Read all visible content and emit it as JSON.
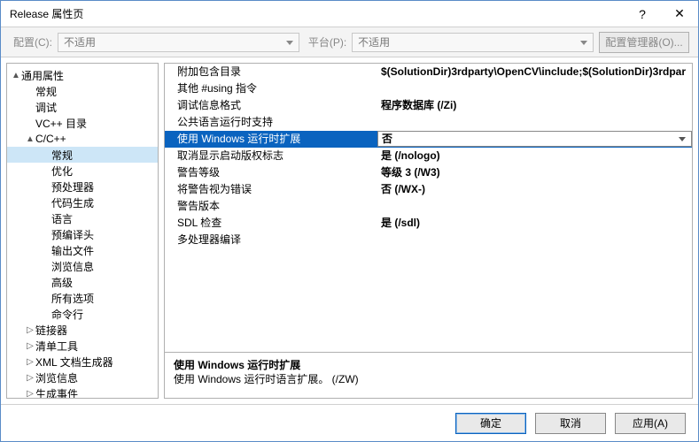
{
  "titlebar": {
    "title": "Release 属性页",
    "help": "?",
    "close": "✕"
  },
  "toolbar": {
    "config_label": "配置(C):",
    "config_value": "不适用",
    "platform_label": "平台(P):",
    "platform_value": "不适用",
    "manager": "配置管理器(O)..."
  },
  "tree": {
    "items": [
      {
        "label": "通用属性",
        "d": 0,
        "exp": "▲"
      },
      {
        "label": "常规",
        "d": 1,
        "exp": ""
      },
      {
        "label": "调试",
        "d": 1,
        "exp": ""
      },
      {
        "label": "VC++ 目录",
        "d": 1,
        "exp": ""
      },
      {
        "label": "C/C++",
        "d": 1,
        "exp": "▲"
      },
      {
        "label": "常规",
        "d": 2,
        "exp": "",
        "sel": true
      },
      {
        "label": "优化",
        "d": 2,
        "exp": ""
      },
      {
        "label": "预处理器",
        "d": 2,
        "exp": ""
      },
      {
        "label": "代码生成",
        "d": 2,
        "exp": ""
      },
      {
        "label": "语言",
        "d": 2,
        "exp": ""
      },
      {
        "label": "预编译头",
        "d": 2,
        "exp": ""
      },
      {
        "label": "输出文件",
        "d": 2,
        "exp": ""
      },
      {
        "label": "浏览信息",
        "d": 2,
        "exp": ""
      },
      {
        "label": "高级",
        "d": 2,
        "exp": ""
      },
      {
        "label": "所有选项",
        "d": 2,
        "exp": ""
      },
      {
        "label": "命令行",
        "d": 2,
        "exp": ""
      },
      {
        "label": "链接器",
        "d": 1,
        "exp": "▷"
      },
      {
        "label": "清单工具",
        "d": 1,
        "exp": "▷"
      },
      {
        "label": "XML 文档生成器",
        "d": 1,
        "exp": "▷"
      },
      {
        "label": "浏览信息",
        "d": 1,
        "exp": "▷"
      },
      {
        "label": "生成事件",
        "d": 1,
        "exp": "▷"
      }
    ]
  },
  "grid": {
    "rows": [
      {
        "name": "附加包含目录",
        "value": "$(SolutionDir)3rdparty\\OpenCV\\include;$(SolutionDir)3rdpar"
      },
      {
        "name": "其他 #using 指令",
        "value": ""
      },
      {
        "name": "调试信息格式",
        "value": "程序数据库 (/Zi)"
      },
      {
        "name": "公共语言运行时支持",
        "value": ""
      },
      {
        "name": "使用 Windows 运行时扩展",
        "value": "否",
        "sel": true
      },
      {
        "name": "取消显示启动版权标志",
        "value": "是 (/nologo)"
      },
      {
        "name": "警告等级",
        "value": "等级 3 (/W3)"
      },
      {
        "name": "将警告视为错误",
        "value": "否 (/WX-)"
      },
      {
        "name": "警告版本",
        "value": ""
      },
      {
        "name": "SDL 检查",
        "value": "是 (/sdl)"
      },
      {
        "name": "多处理器编译",
        "value": ""
      }
    ]
  },
  "desc": {
    "heading": "使用 Windows 运行时扩展",
    "body": "使用 Windows 运行时语言扩展。   (/ZW)"
  },
  "footer": {
    "ok": "确定",
    "cancel": "取消",
    "apply": "应用(A)"
  }
}
